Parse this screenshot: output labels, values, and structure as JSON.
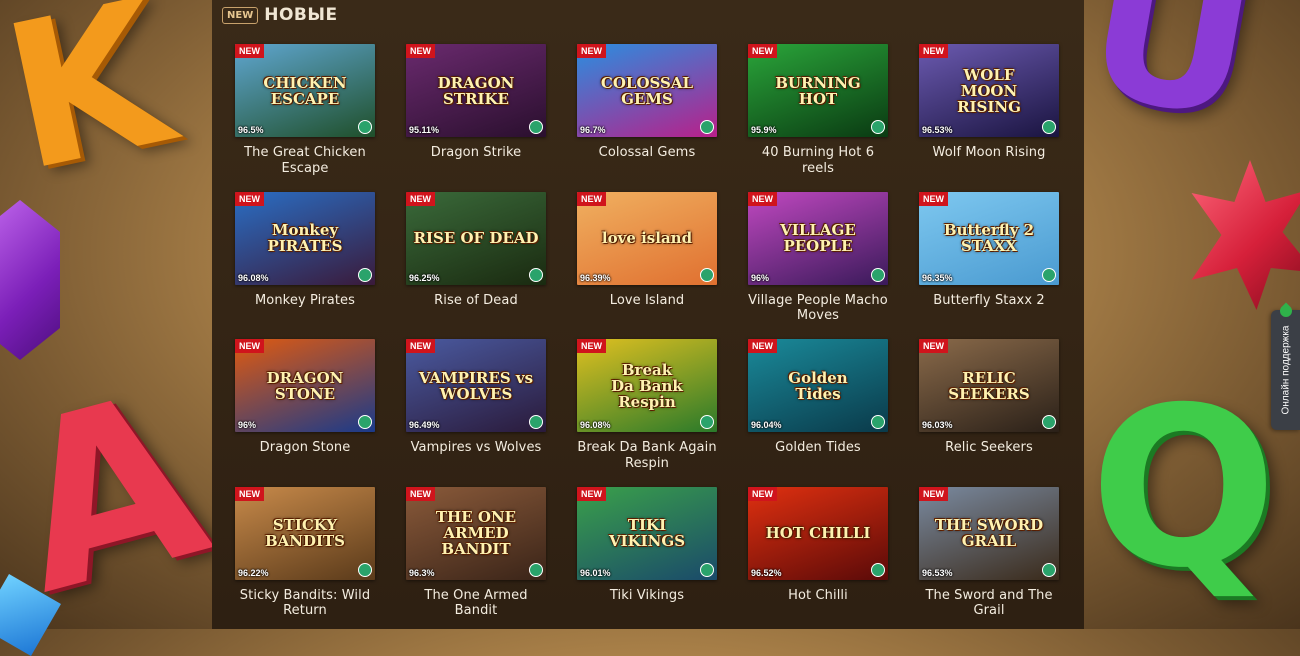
{
  "section": {
    "badge": "NEW",
    "title": "НОВЫЕ"
  },
  "support": {
    "label": "Онлайн поддержка"
  },
  "games": [
    {
      "name": "The Great Chicken Escape",
      "badge": "NEW",
      "rtp": "96.5%",
      "art": "CHICKEN ESCAPE",
      "c1": "#5fa6d0",
      "c2": "#1f4f2a"
    },
    {
      "name": "Dragon Strike",
      "badge": "NEW",
      "rtp": "95.11%",
      "art": "DRAGON\nSTRIKE",
      "c1": "#6a2a6e",
      "c2": "#2a0f2e"
    },
    {
      "name": "Colossal Gems",
      "badge": "NEW",
      "rtp": "96.7%",
      "art": "COLOSSAL\nGEMS",
      "c1": "#2a8ee0",
      "c2": "#b8208a"
    },
    {
      "name": "40 Burning Hot 6 reels",
      "badge": "NEW",
      "rtp": "95.9%",
      "art": "BURNING HOT",
      "c1": "#2aa53a",
      "c2": "#0a3a12"
    },
    {
      "name": "Wolf Moon Rising",
      "badge": "NEW",
      "rtp": "96.53%",
      "art": "WOLF\nMOON\nRISING",
      "c1": "#6b5ab0",
      "c2": "#1a1440"
    },
    {
      "name": "Monkey Pirates",
      "badge": "NEW",
      "rtp": "96.08%",
      "art": "Monkey\nPIRATES",
      "c1": "#2a6ec4",
      "c2": "#3a1a3a"
    },
    {
      "name": "Rise of Dead",
      "badge": "NEW",
      "rtp": "96.25%",
      "art": "RISE OF DEAD",
      "c1": "#3a6a3a",
      "c2": "#1a2a10"
    },
    {
      "name": "Love Island",
      "badge": "NEW",
      "rtp": "96.39%",
      "art": "love island",
      "c1": "#f0b060",
      "c2": "#e07030"
    },
    {
      "name": "Village People Macho Moves",
      "badge": "NEW",
      "rtp": "96%",
      "art": "VILLAGE PEOPLE",
      "c1": "#c048c0",
      "c2": "#3a1a5a"
    },
    {
      "name": "Butterfly Staxx 2",
      "badge": "NEW",
      "rtp": "96.35%",
      "art": "Butterfly 2\nSTAXX",
      "c1": "#7ec8f0",
      "c2": "#4a9ad0"
    },
    {
      "name": "Dragon Stone",
      "badge": "NEW",
      "rtp": "96%",
      "art": "DRAGON\nSTONE",
      "c1": "#e05a10",
      "c2": "#1a3a8a"
    },
    {
      "name": "Vampires vs Wolves",
      "badge": "NEW",
      "rtp": "96.49%",
      "art": "VAMPIRES vs WOLVES",
      "c1": "#4a5aa0",
      "c2": "#2a1a3a"
    },
    {
      "name": "Break Da Bank Again Respin",
      "badge": "NEW",
      "rtp": "96.08%",
      "art": "Break\nDa Bank\nRespin",
      "c1": "#e0c020",
      "c2": "#2a7a2a"
    },
    {
      "name": "Golden Tides",
      "badge": "NEW",
      "rtp": "96.04%",
      "art": "Golden\nTides",
      "c1": "#1a8a9a",
      "c2": "#0a3a4a"
    },
    {
      "name": "Relic Seekers",
      "badge": "NEW",
      "rtp": "96.03%",
      "art": "RELIC\nSEEKERS",
      "c1": "#8a6a4a",
      "c2": "#2a2018"
    },
    {
      "name": "Sticky Bandits: Wild Return",
      "badge": "NEW",
      "rtp": "96.22%",
      "art": "STICKY\nBANDITS",
      "c1": "#c88a4a",
      "c2": "#5a3a1a"
    },
    {
      "name": "The One Armed Bandit",
      "badge": "NEW",
      "rtp": "96.3%",
      "art": "THE ONE ARMED\nBANDIT",
      "c1": "#8a5a3a",
      "c2": "#3a2418"
    },
    {
      "name": "Tiki Vikings",
      "badge": "NEW",
      "rtp": "96.01%",
      "art": "TIKI\nVIKINGS",
      "c1": "#3aa04a",
      "c2": "#1a4a6a"
    },
    {
      "name": "Hot Chilli",
      "badge": "NEW",
      "rtp": "96.52%",
      "art": "HOT CHILLI",
      "c1": "#e03010",
      "c2": "#5a0a08"
    },
    {
      "name": "The Sword and The Grail",
      "badge": "NEW",
      "rtp": "96.53%",
      "art": "THE SWORD\nGRAIL",
      "c1": "#7a8aa0",
      "c2": "#3a2a1a"
    }
  ]
}
